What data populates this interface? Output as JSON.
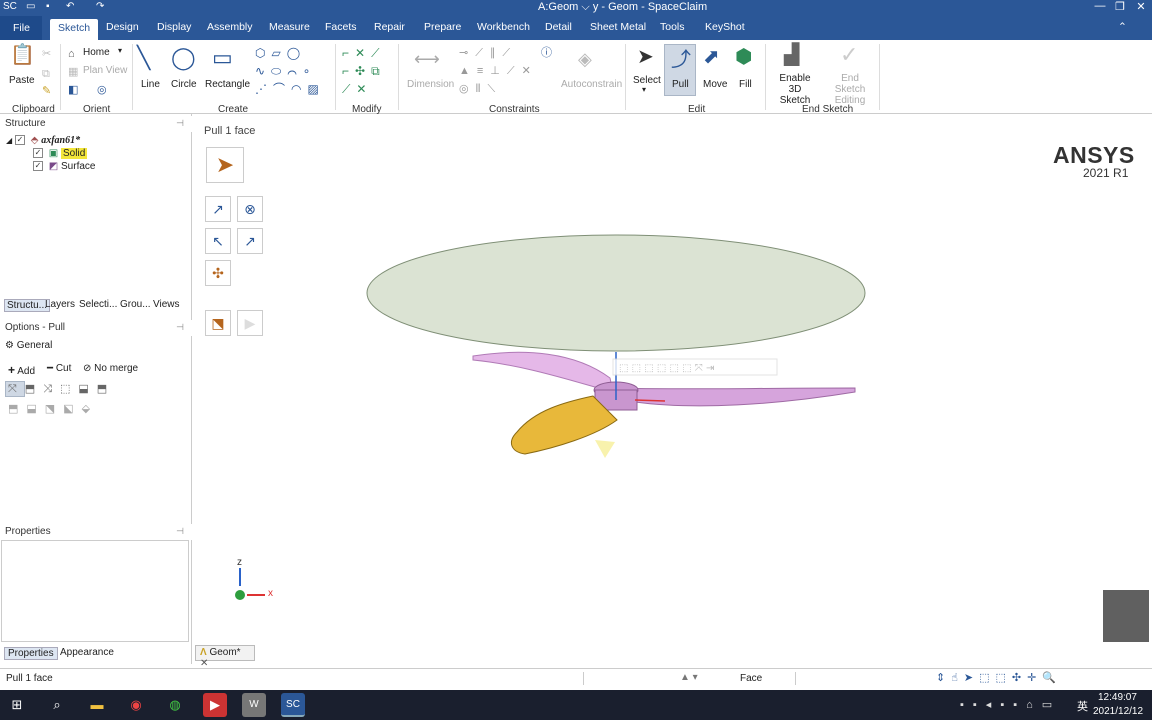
{
  "window": {
    "title": "A:Geom",
    "title_app": "y - Geom - SpaceClaim"
  },
  "menu": [
    "File",
    "Sketch",
    "Design",
    "Display",
    "Assembly",
    "Measure",
    "Facets",
    "Repair",
    "Prepare",
    "Workbench",
    "Detail",
    "Sheet Metal",
    "Tools",
    "KeyShot"
  ],
  "ribbon": {
    "clipboard": {
      "paste": "Paste",
      "group": "Clipboard"
    },
    "orient": {
      "home": "Home",
      "plan_view": "Plan View",
      "group": "Orient"
    },
    "create": {
      "line": "Line",
      "circle": "Circle",
      "rectangle": "Rectangle",
      "group": "Create"
    },
    "modify": {
      "group": "Modify"
    },
    "constraints": {
      "dimension": "Dimension",
      "autoconstrain": "Autoconstrain",
      "group": "Constraints"
    },
    "edit": {
      "select": "Select",
      "pull": "Pull",
      "move": "Move",
      "fill": "Fill",
      "group": "Edit"
    },
    "end_sketch": {
      "enable_3d": "Enable 3D Sketch",
      "end_editing": "End Sketch Editing",
      "group": "End Sketch"
    }
  },
  "structure": {
    "header": "Structure",
    "root": "axfan61*",
    "items": [
      "Solid",
      "Surface"
    ],
    "tabs": [
      "Structu...",
      "Layers",
      "Selecti...",
      "Grou...",
      "Views"
    ]
  },
  "options": {
    "header": "Options - Pull",
    "general": "General",
    "add": "Add",
    "cut": "Cut",
    "no_merge": "No merge"
  },
  "properties": {
    "header": "Properties",
    "tabs": [
      "Properties",
      "Appearance"
    ]
  },
  "viewport": {
    "label": "Pull 1 face",
    "brand": "ANSYS",
    "version": "2021 R1",
    "axis_z": "z",
    "axis_x": "x",
    "doc_tab": "Geom*"
  },
  "status": {
    "left": "Pull 1 face",
    "mode": "Face"
  },
  "taskbar": {
    "time": "12:49:07",
    "date": "2021/12/12",
    "ime": "英"
  }
}
